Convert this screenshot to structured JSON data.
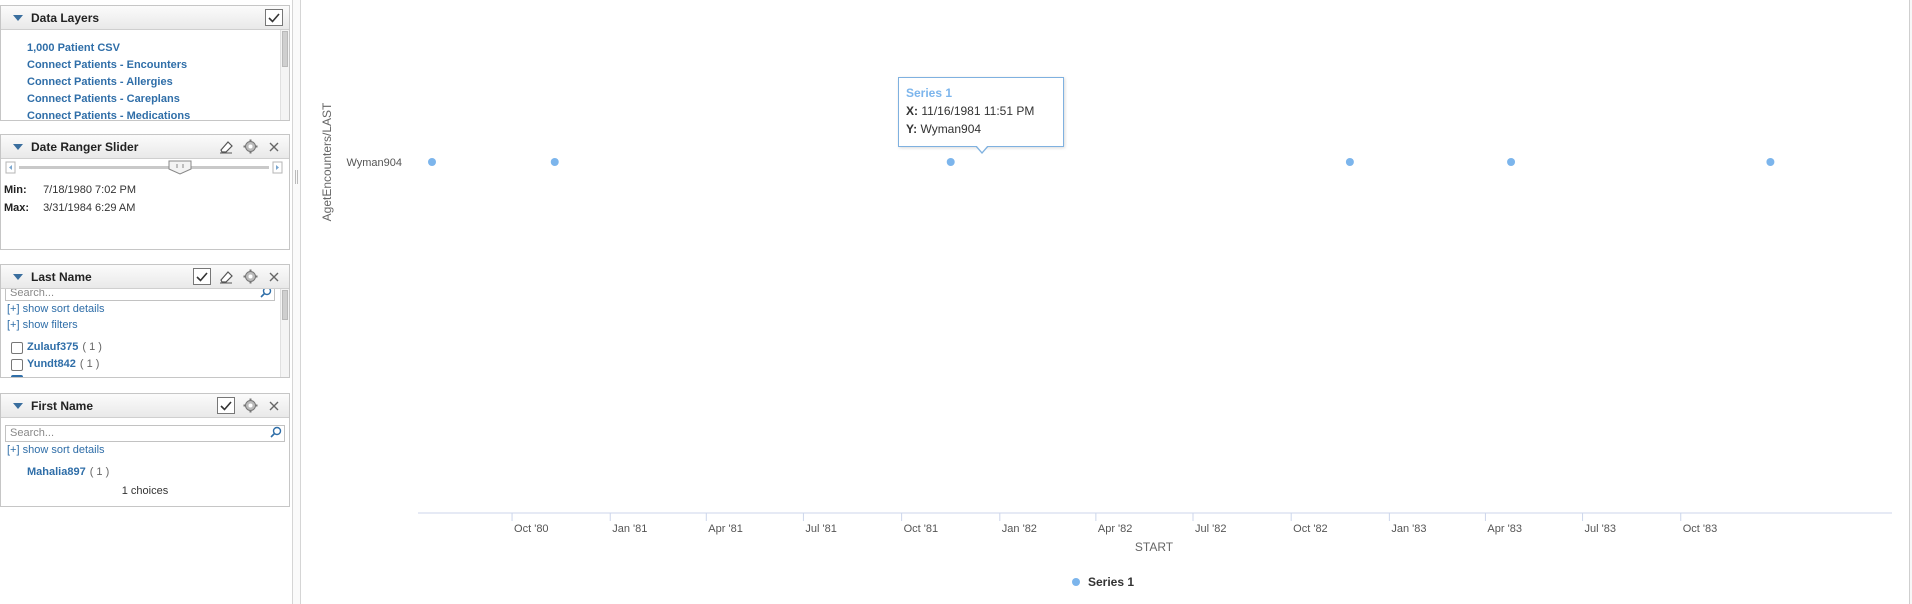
{
  "panels": {
    "data_layers": {
      "title": "Data Layers",
      "items": [
        "1,000 Patient CSV",
        "Connect Patients - Encounters",
        "Connect Patients - Allergies",
        "Connect Patients - Careplans",
        "Connect Patients - Medications"
      ]
    },
    "date_slider": {
      "title": "Date Ranger Slider",
      "min_label": "Min:",
      "min_value": "7/18/1980 7:02 PM",
      "max_label": "Max:",
      "max_value": "3/31/1984 6:29 AM"
    },
    "last_name": {
      "title": "Last Name",
      "search_placeholder": "Search...",
      "show_sort": "[+] show sort details",
      "show_filters": "[+] show filters",
      "choices": [
        {
          "name": "Zulauf375",
          "count": "( 1 )"
        },
        {
          "name": "Yundt842",
          "count": "( 1 )"
        }
      ]
    },
    "first_name": {
      "title": "First Name",
      "search_placeholder": "Search...",
      "show_sort": "[+] show sort details",
      "choices": [
        {
          "name": "Mahalia897",
          "count": "( 1 )"
        }
      ],
      "choices_count": "1 choices"
    }
  },
  "chart_data": {
    "type": "scatter",
    "xlabel": "START",
    "ylabel": "AgetEncounters/LAST",
    "categories": [
      "Wyman904"
    ],
    "x_ticks": [
      "Oct '80",
      "Jan '81",
      "Apr '81",
      "Jul '81",
      "Oct '81",
      "Jan '82",
      "Apr '82",
      "Jul '82",
      "Oct '82",
      "Jan '83",
      "Apr '83",
      "Jul '83",
      "Oct '83"
    ],
    "x_range": [
      "1980-07-18",
      "1984-03-31"
    ],
    "series": [
      {
        "name": "Series 1",
        "color": "#7cb5ec",
        "points": [
          {
            "x": "1980-07-18",
            "y": "Wyman904"
          },
          {
            "x": "1980-11-10",
            "y": "Wyman904"
          },
          {
            "x": "1981-11-16",
            "y": "Wyman904"
          },
          {
            "x": "1982-11-25",
            "y": "Wyman904"
          },
          {
            "x": "1983-04-25",
            "y": "Wyman904"
          },
          {
            "x": "1983-12-24",
            "y": "Wyman904"
          }
        ]
      }
    ],
    "legend": "bottom-center",
    "tooltip": {
      "series": "Series 1",
      "x_label": "X",
      "x_value": "11/16/1981 11:51 PM",
      "y_label": "Y",
      "y_value": "Wyman904"
    }
  }
}
